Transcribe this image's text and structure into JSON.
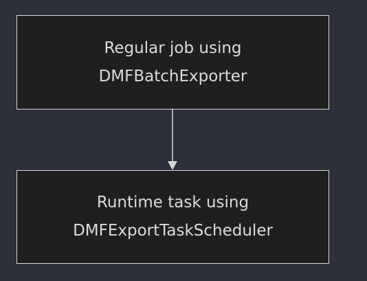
{
  "diagram": {
    "nodes": [
      {
        "id": "regular-job",
        "lines": [
          "Regular job using",
          "DMFBatchExporter"
        ]
      },
      {
        "id": "runtime-task",
        "lines": [
          "Runtime task using",
          "DMFExportTaskScheduler"
        ]
      }
    ],
    "edges": [
      {
        "from": "regular-job",
        "to": "runtime-task"
      }
    ],
    "colors": {
      "background": "#2b303b",
      "node_fill": "#1f1f1f",
      "node_border": "#d6d6d6",
      "text": "#dcdcdc",
      "edge": "#d6d6d6"
    }
  }
}
